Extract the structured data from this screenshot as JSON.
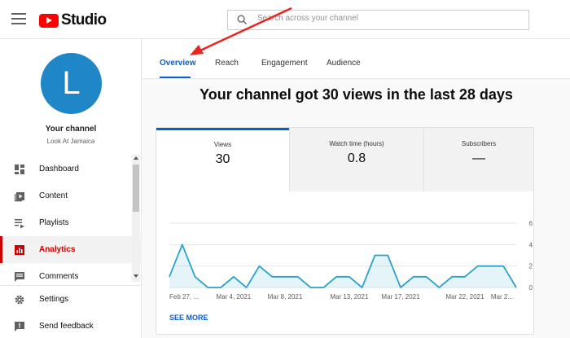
{
  "app": {
    "logo_text": "Studio",
    "search_placeholder": "Search across your channel"
  },
  "sidebar": {
    "avatar_letter": "L",
    "channel_title": "Your channel",
    "channel_name": "Look At Jamaica",
    "items": [
      {
        "label": "Dashboard",
        "icon": "dashboard-icon"
      },
      {
        "label": "Content",
        "icon": "content-icon"
      },
      {
        "label": "Playlists",
        "icon": "playlists-icon"
      },
      {
        "label": "Analytics",
        "icon": "analytics-icon",
        "active": true
      },
      {
        "label": "Comments",
        "icon": "comments-icon"
      }
    ],
    "bottom_items": [
      {
        "label": "Settings",
        "icon": "gear-icon"
      },
      {
        "label": "Send feedback",
        "icon": "feedback-icon"
      }
    ]
  },
  "tabs": [
    {
      "label": "Overview",
      "active": true
    },
    {
      "label": "Reach"
    },
    {
      "label": "Engagement"
    },
    {
      "label": "Audience"
    }
  ],
  "headline": "Your channel got 30 views in the last 28 days",
  "metrics": [
    {
      "label": "Views",
      "value": "30",
      "selected": true
    },
    {
      "label": "Watch time (hours)",
      "value": "0.8"
    },
    {
      "label": "Subscribers",
      "value": "—"
    }
  ],
  "see_more": "SEE MORE",
  "colors": {
    "accent": "#065fd4",
    "brand_red": "#ff0000",
    "active_nav": "#cc0000",
    "avatar": "#1f86c8",
    "line": "#29a4c8",
    "annotation_arrow": "#e8261f"
  },
  "chart_data": {
    "type": "area",
    "x": [
      "Feb 27",
      "Feb 28",
      "Mar 1",
      "Mar 2",
      "Mar 3",
      "Mar 4",
      "Mar 5",
      "Mar 6",
      "Mar 7",
      "Mar 8",
      "Mar 9",
      "Mar 10",
      "Mar 11",
      "Mar 12",
      "Mar 13",
      "Mar 14",
      "Mar 15",
      "Mar 16",
      "Mar 17",
      "Mar 18",
      "Mar 19",
      "Mar 20",
      "Mar 21",
      "Mar 22",
      "Mar 23",
      "Mar 24",
      "Mar 25",
      "Mar 26"
    ],
    "x_tick_labels": [
      "Feb 27, ...",
      "Mar 4, 2021",
      "Mar 8, 2021",
      "Mar 13, 2021",
      "Mar 17, 2021",
      "Mar 22, 2021",
      "Mar 2..."
    ],
    "series": [
      {
        "values": [
          1,
          4,
          1,
          0,
          0,
          1,
          0,
          2,
          1,
          1,
          1,
          0,
          0,
          1,
          1,
          0,
          3,
          3,
          0,
          1,
          1,
          0,
          1,
          1,
          2,
          2,
          2,
          0
        ]
      }
    ],
    "y_ticks": [
      0,
      2,
      4,
      6
    ],
    "ylim": [
      0,
      6
    ],
    "grid": true,
    "x_axis": "dates"
  }
}
